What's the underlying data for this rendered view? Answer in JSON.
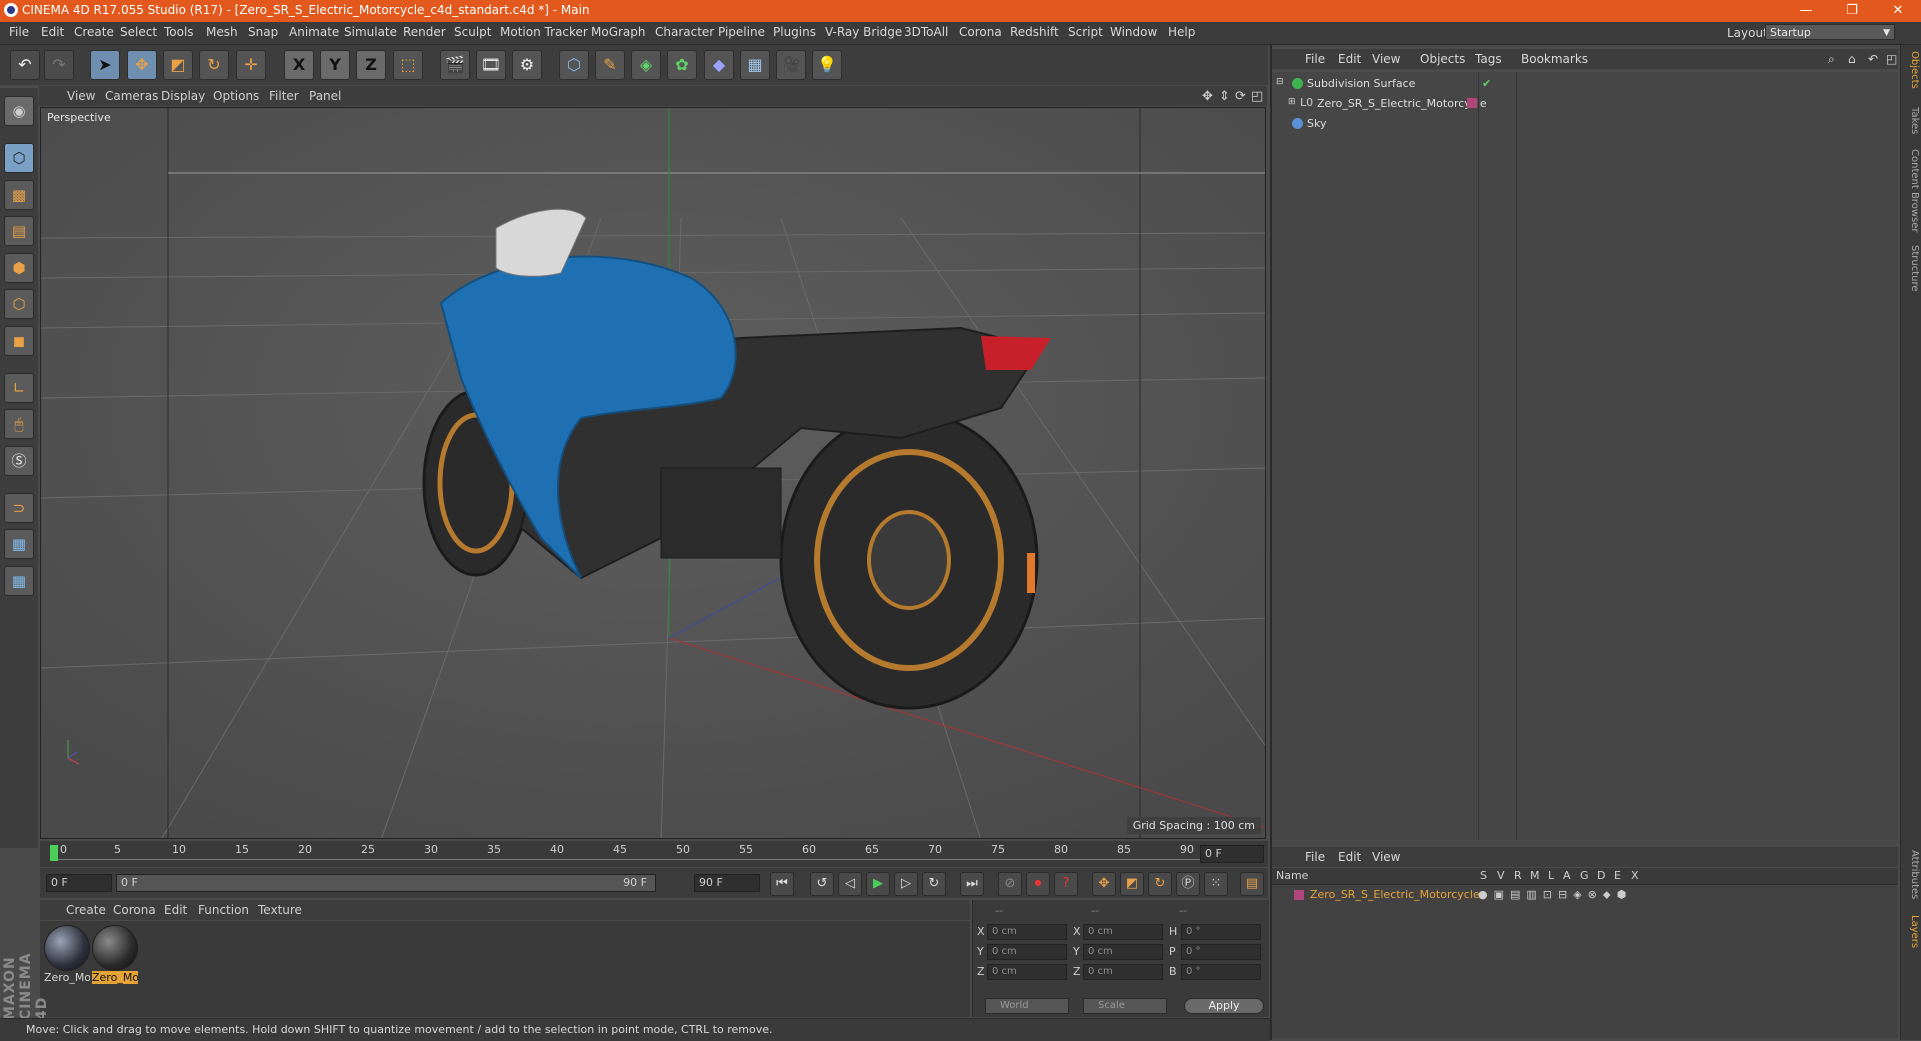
{
  "window": {
    "title": "CINEMA 4D R17.055 Studio (R17) - [Zero_SR_S_Electric_Motorcycle_c4d_standart.c4d *] - Main",
    "minimize": "—",
    "restore": "❐",
    "close": "✕"
  },
  "menu": {
    "items": [
      "File",
      "Edit",
      "Create",
      "Select",
      "Tools",
      "Mesh",
      "Snap",
      "Animate",
      "Simulate",
      "Render",
      "Sculpt",
      "Motion Tracker",
      "MoGraph",
      "Character",
      "Pipeline",
      "Plugins",
      "V-Ray Bridge",
      "3DToAll",
      "Corona",
      "Redshift",
      "Script",
      "Window",
      "Help"
    ],
    "layout_label": "Layout:",
    "layout_value": "Startup"
  },
  "toolbar": {
    "undo_glyph": "↶",
    "redo_glyph": "↷",
    "x": "X",
    "y": "Y",
    "z": "Z"
  },
  "viewport": {
    "menu": [
      "View",
      "Cameras",
      "Display",
      "Options",
      "Filter",
      "Panel"
    ],
    "label": "Perspective",
    "grid_spacing": "Grid Spacing : 100 cm"
  },
  "timeline": {
    "ticks": [
      "0",
      "5",
      "10",
      "15",
      "20",
      "25",
      "30",
      "35",
      "40",
      "45",
      "50",
      "55",
      "60",
      "65",
      "70",
      "75",
      "80",
      "85",
      "90"
    ],
    "end_field": "0 F",
    "start": "0 F",
    "range_start": "0 F",
    "range_end": "90 F",
    "max": "90 F"
  },
  "materials": {
    "menu": [
      "Create",
      "Corona",
      "Edit",
      "Function",
      "Texture"
    ],
    "items": [
      {
        "label": "Zero_Mo",
        "selected": false
      },
      {
        "label": "Zero_Mo",
        "selected": true
      }
    ]
  },
  "coords": {
    "headers": [
      "--",
      "--",
      "--"
    ],
    "rows": [
      {
        "a": "X",
        "av": "0 cm",
        "b": "X",
        "bv": "0 cm",
        "c": "H",
        "cv": "0 °"
      },
      {
        "a": "Y",
        "av": "0 cm",
        "b": "Y",
        "bv": "0 cm",
        "c": "P",
        "cv": "0 °"
      },
      {
        "a": "Z",
        "av": "0 cm",
        "b": "Z",
        "bv": "0 cm",
        "c": "B",
        "cv": "0 °"
      }
    ],
    "world": "World",
    "scale": "Scale",
    "apply": "Apply"
  },
  "status": "Move: Click and drag to move elements. Hold down SHIFT to quantize movement / add to the selection in point mode, CTRL to remove.",
  "objects_panel": {
    "menu": [
      "File",
      "Edit",
      "View",
      "Objects",
      "Tags",
      "Bookmarks"
    ],
    "rows": [
      {
        "name": "Subdivision Surface",
        "color": "#3fb34f"
      },
      {
        "name": "Zero_SR_S_Electric_Motorcycle",
        "color": "#9aa0a6"
      },
      {
        "name": "Sky",
        "color": "#5b8fd6"
      }
    ]
  },
  "layers_panel": {
    "menu": [
      "File",
      "Edit",
      "View"
    ],
    "header": {
      "name": "Name",
      "cols": [
        "S",
        "V",
        "R",
        "M",
        "L",
        "A",
        "G",
        "D",
        "E",
        "X"
      ]
    },
    "rows": [
      {
        "name": "Zero_SR_S_Electric_Motorcycle",
        "color": "#b0457a"
      }
    ]
  },
  "right_tabs": [
    "Objects",
    "Takes",
    "Content Browser",
    "Structure",
    "Attributes",
    "Layers"
  ],
  "maxon": "MAXON CINEMA 4D"
}
